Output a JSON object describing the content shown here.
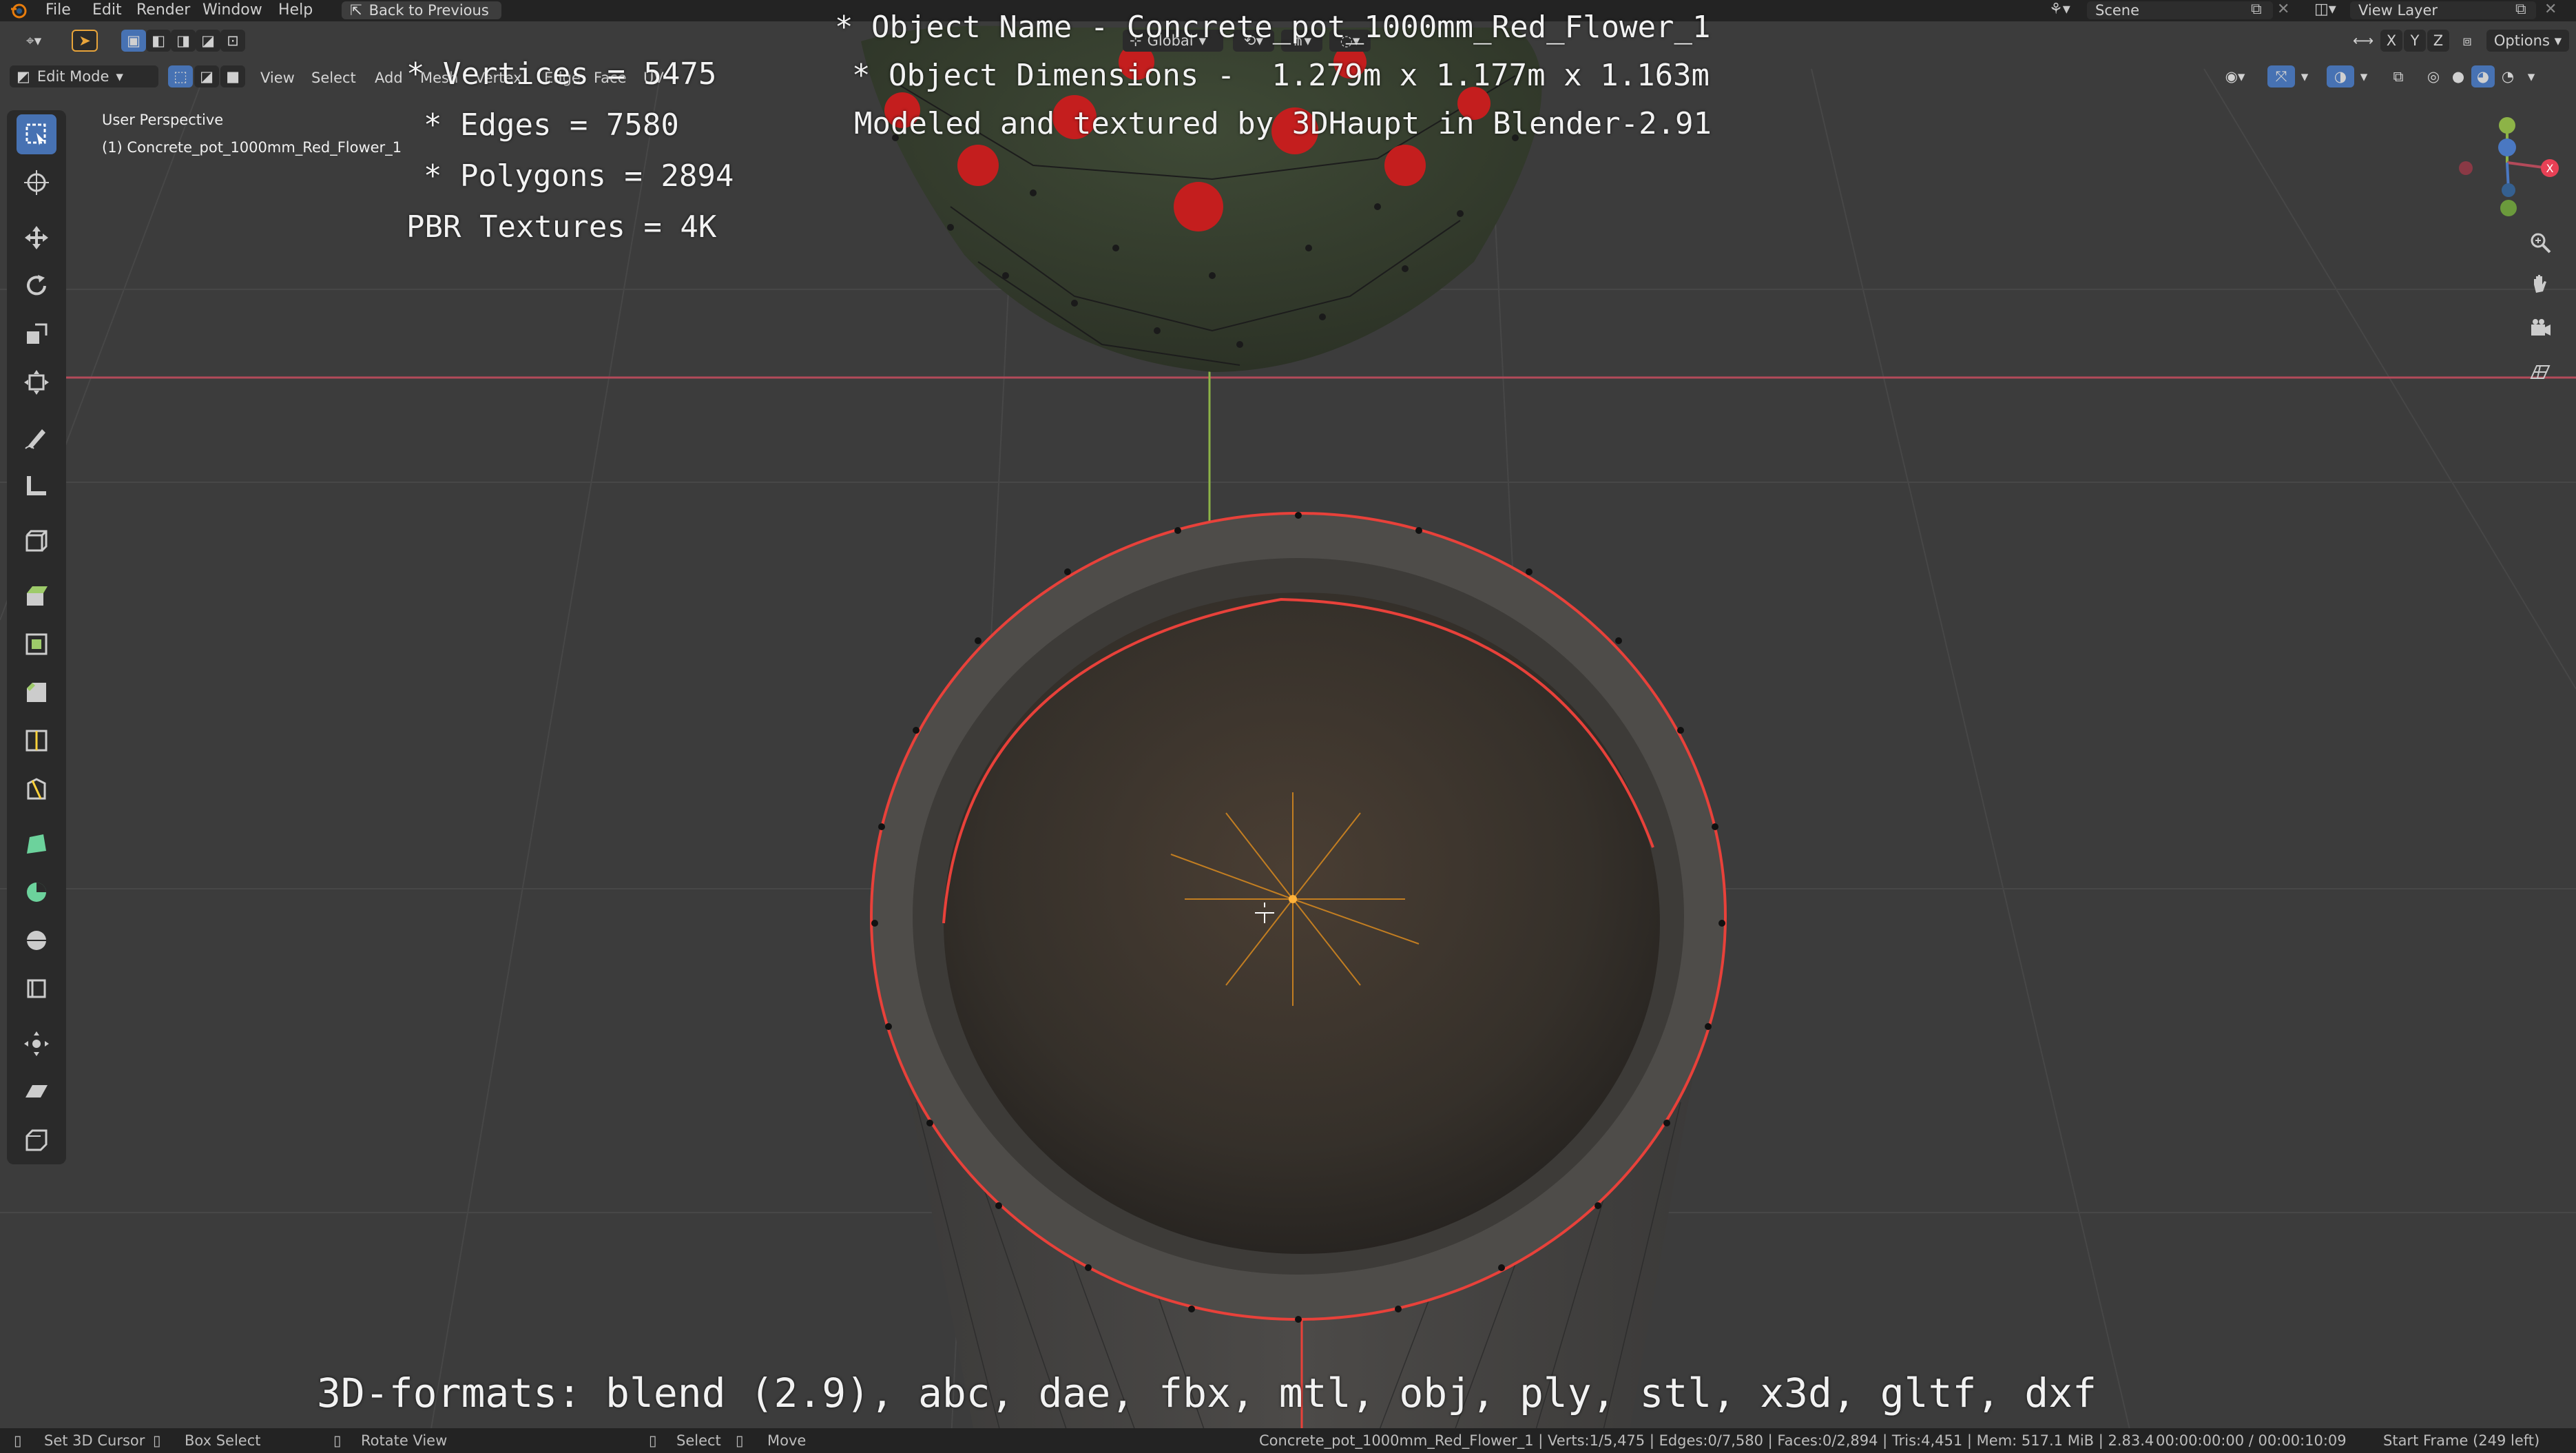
{
  "topbar": {
    "menus": [
      "File",
      "Edit",
      "Render",
      "Window",
      "Help"
    ],
    "back_button": "Back to Previous",
    "scene": "Scene",
    "view_layer": "View Layer"
  },
  "header": {
    "mode": "Edit Mode",
    "menus": [
      "View",
      "Select",
      "Add",
      "Mesh",
      "Vertex",
      "Edge",
      "Face",
      "UV"
    ],
    "transform_orientation": "Global",
    "axes": [
      "X",
      "Y",
      "Z"
    ],
    "options_label": "Options"
  },
  "viewport": {
    "perspective": "User Perspective",
    "active_object": "(1) Concrete_pot_1000mm_Red_Flower_1"
  },
  "overlay": {
    "stats": [
      "* Vertices = 5475",
      "* Edges = 7580",
      "* Polygons = 2894",
      "PBR Textures = 4K"
    ],
    "object_lines": [
      "* Object Name - Concrete_pot_1000mm_Red_Flower_1",
      "* Object Dimensions -  1.279m x 1.177m x 1.163m",
      "Modeled and textured by 3DHaupt in Blender-2.91"
    ],
    "formats": "3D-formats: blend (2.9), abc, dae, fbx, mtl, obj, ply, stl, x3d, gltf, dxf"
  },
  "statusbar": {
    "set_cursor": "Set 3D Cursor",
    "box_select": "Box Select",
    "rotate_view": "Rotate View",
    "select": "Select",
    "move": "Move",
    "stats": "Concrete_pot_1000mm_Red_Flower_1 | Verts:1/5,475 | Edges:0/7,580 | Faces:0/2,894 | Tris:4,451 | Mem: 517.1 MiB | 2.83.4",
    "time": "00:00:00:00 / 00:00:10:09",
    "frame": "Start Frame (249 left)"
  },
  "colors": {
    "background": "#3c3c3c",
    "accent": "#4772b3",
    "selection_edge": "#e8413a",
    "x_axis": "#b34a5a",
    "y_axis": "#8db347",
    "flower": "#c41e1e"
  },
  "icons": [
    "blender-logo",
    "select-box",
    "cursor",
    "move",
    "rotate",
    "scale",
    "transform",
    "annotate",
    "measure",
    "add-cube",
    "extrude",
    "inset",
    "bevel",
    "loop-cut",
    "knife",
    "poly-build",
    "spin",
    "smooth",
    "edge-slide",
    "shrink-fatten",
    "shear",
    "rip",
    "zoom",
    "hand",
    "camera",
    "grid"
  ]
}
